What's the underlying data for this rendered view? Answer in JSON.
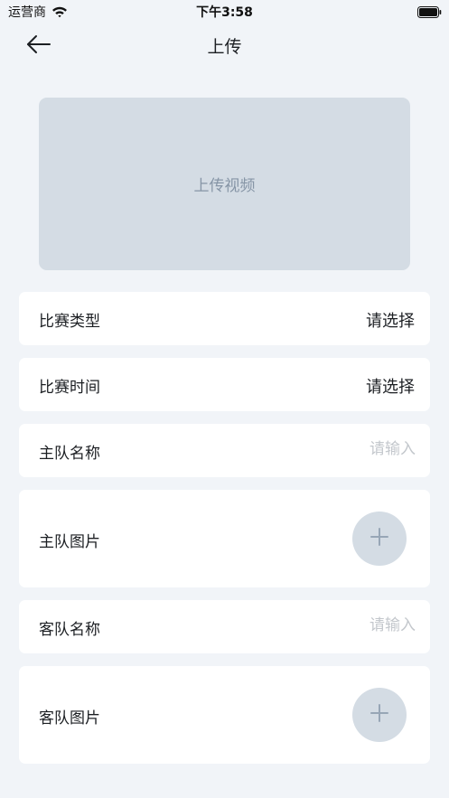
{
  "status_bar": {
    "carrier": "运营商",
    "time": "下午3:58",
    "wifi_icon": "wifi-icon",
    "battery_icon": "battery-full-icon"
  },
  "nav": {
    "back_icon": "arrow-left-icon",
    "title": "上传"
  },
  "upload": {
    "label": "上传视频"
  },
  "form": {
    "match_type": {
      "label": "比赛类型",
      "value": "请选择"
    },
    "match_time": {
      "label": "比赛时间",
      "value": "请选择"
    },
    "home_name": {
      "label": "主队名称",
      "placeholder": "请输入"
    },
    "home_image": {
      "label": "主队图片",
      "icon": "plus-icon"
    },
    "away_name": {
      "label": "客队名称",
      "placeholder": "请输入"
    },
    "away_image": {
      "label": "客队图片",
      "icon": "plus-icon"
    }
  },
  "colors": {
    "background": "#f1f4f8",
    "card": "#ffffff",
    "placeholder_fill": "#d4dce4",
    "muted_text": "#8695a6",
    "placeholder_text": "#c3c7cc"
  }
}
